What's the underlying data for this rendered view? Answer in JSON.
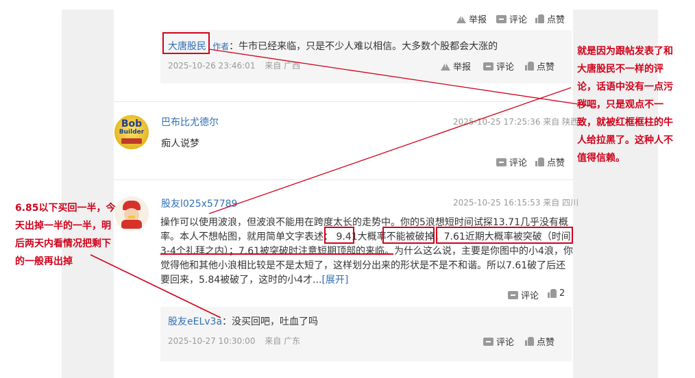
{
  "top_actions": {
    "report": "举报",
    "comment": "评论",
    "like": "点赞"
  },
  "reply1": {
    "author": "大唐股民",
    "author_tag": "作者",
    "text": "：牛市已经来临，只是不少人难以相信。大多数个股都会大涨的",
    "time": "2025-10-26 23:46:01",
    "location": "来自 广西",
    "report": "举报",
    "comment": "评论",
    "like": "点赞"
  },
  "comment2": {
    "author": "巴布比尤德尔",
    "avatar_text_top": "Bob",
    "avatar_text_mid": "Builder",
    "meta": "2025-10-25 17:25:36 来自 陕西",
    "text": "痴人说梦",
    "comment": "评论",
    "like": "点赞"
  },
  "comment3": {
    "author": "股友l025x57789",
    "meta": "2025-10-25 16:15:53 来自 四川",
    "body_1": "操作可以使用波浪，但波浪不能用在跨度太长的走势中。你的5浪想短时间试探13.71几乎没有概率。本人不想帖图，就用简单文字表述：",
    "body_941": "9.41",
    "body_dagai": "大概率",
    "body_nengbei": "不能被破掉",
    "body_semi": "；",
    "body_761": "7.61近期大概率被突破（时间3-4个礼拜之内）；7.61被突破时注意短期顶部的来临。",
    "body_rest": "为什么这么说，主要是你图中的小4浪，你觉得他和其他小浪相比较是不是太短了，这样划分出来的形状是不是不和谐。所以7.61破了后还要回来，5.84被破了，这时的小4才...",
    "expand": "[展开]",
    "comment": "评论",
    "like_count": "2"
  },
  "reply3": {
    "author": "股友eELv3a",
    "text": "：没买回吧，吐血了吗",
    "time": "2025-10-27 10:30:00",
    "location": "来自 广东",
    "comment": "评论",
    "like": "点赞"
  },
  "annotations": {
    "right": "就是因为跟帖发表了和大唐股民不一样的评论，话语中没有一点污秽吧，只是观点不一致，就被红框框柱的牛人给拉黑了。这种人不值得信赖。",
    "left": "6.85以下买回一半，今天出掉一半的一半，明后两天内看情况把剩下的一般再出掉"
  },
  "colors": {
    "accent": "#2f6fb5",
    "annotation": "#d0021b",
    "muted": "#999999"
  }
}
